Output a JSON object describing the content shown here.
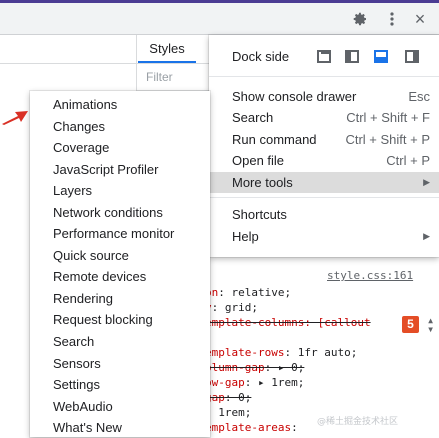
{
  "toolbar": {
    "settings_icon": "gear-icon",
    "more_icon": "vertical-dots-icon",
    "close_label": "×"
  },
  "panel": {
    "styles_tab": "Styles",
    "filter_placeholder": "Filter"
  },
  "main_menu": {
    "dock_side_label": "Dock side",
    "dock_options": [
      "undock-into-separate-window",
      "dock-to-left",
      "dock-to-bottom",
      "dock-to-right"
    ],
    "dock_selected": "dock-to-bottom",
    "items": [
      {
        "label": "Show console drawer",
        "shortcut": "Esc"
      },
      {
        "label": "Search",
        "shortcut": "Ctrl + Shift + F"
      },
      {
        "label": "Run command",
        "shortcut": "Ctrl + Shift + P"
      },
      {
        "label": "Open file",
        "shortcut": "Ctrl + P"
      },
      {
        "label": "More tools",
        "arrow": "▶"
      },
      {
        "label": "Shortcuts"
      },
      {
        "label": "Help",
        "arrow": "▶"
      }
    ]
  },
  "tools_menu": {
    "items": [
      "Animations",
      "Changes",
      "Coverage",
      "JavaScript Profiler",
      "Layers",
      "Network conditions",
      "Performance monitor",
      "Quick source",
      "Remote devices",
      "Rendering",
      "Request blocking",
      "Search",
      "Sensors",
      "Settings",
      "WebAudio",
      "What's New"
    ]
  },
  "code": {
    "source_link": "style.css:161",
    "lines": [
      {
        "prop": "on",
        "value": ": relative;"
      },
      {
        "prop": "y",
        "value": ": grid;"
      },
      {
        "prop": "emplate-columns: [callout",
        "value": "",
        "struck": true
      },
      {
        "prop": "emplate-rows",
        "value": ": 1fr auto;"
      },
      {
        "prop": "olumn-gap",
        "value": ": ▸ 0;",
        "struck": true
      },
      {
        "prop": "ow-gap",
        "value": ": ▸ 1rem;"
      },
      {
        "prop": "gap",
        "value": ": 0;",
        "struck": true
      },
      {
        "prop": "",
        "value": ": 1rem;"
      },
      {
        "prop": "emplate-areas",
        "value": ":"
      }
    ],
    "css3_badge": "5",
    "watermark": "@稀土掘金技术社区"
  },
  "colors": {
    "accent": "#1a73e8",
    "top_border": "#4b3c93",
    "pointer": "#d93025"
  }
}
